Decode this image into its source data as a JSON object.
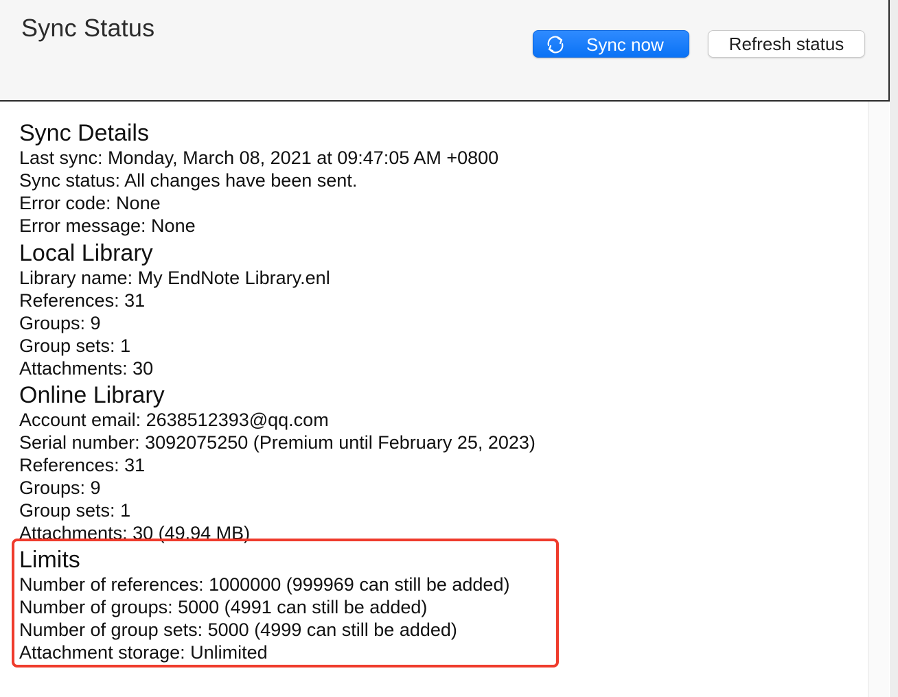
{
  "window": {
    "title": "Sync Status"
  },
  "toolbar": {
    "sync_now_label": "Sync now",
    "refresh_label": "Refresh status"
  },
  "sync_details": {
    "heading": "Sync Details",
    "last_sync": "Last sync: Monday, March 08, 2021 at 09:47:05 AM +0800",
    "sync_status": "Sync status: All changes have been sent.",
    "error_code": "Error code: None",
    "error_message": "Error message: None"
  },
  "local_library": {
    "heading": "Local Library",
    "library_name": "Library name: My EndNote Library.enl",
    "references": "References: 31",
    "groups": "Groups: 9",
    "group_sets": "Group sets: 1",
    "attachments": "Attachments: 30"
  },
  "online_library": {
    "heading": "Online Library",
    "account_email": "Account email: 2638512393@qq.com",
    "serial_number": "Serial number: 3092075250 (Premium until February 25, 2023)",
    "references": "References: 31",
    "groups": "Groups: 9",
    "group_sets": "Group sets: 1",
    "attachments": "Attachments: 30 (49.94 MB)"
  },
  "limits": {
    "heading": "Limits",
    "references": "Number of references: 1000000 (999969 can still be added)",
    "groups": "Number of groups: 5000 (4991 can still be added)",
    "group_sets": "Number of group sets: 5000 (4999 can still be added)",
    "attachment_storage": "Attachment storage: Unlimited"
  },
  "colors": {
    "primary_button": "#0a72f5",
    "highlight": "#ef3b2c",
    "header_bg": "#f6f6f6"
  }
}
